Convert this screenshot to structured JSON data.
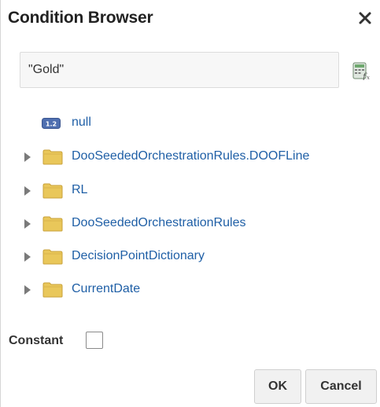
{
  "dialog": {
    "title": "Condition Browser",
    "close_icon": "close-icon"
  },
  "search": {
    "value": "\"Gold\"",
    "placeholder": ""
  },
  "expression_builder": {
    "icon": "expression-builder-icon"
  },
  "tree": {
    "items": [
      {
        "label": "null",
        "icon": "null-value-icon",
        "expandable": false
      },
      {
        "label": "DooSeededOrchestrationRules.DOOFLine",
        "icon": "folder-icon",
        "expandable": true
      },
      {
        "label": "RL",
        "icon": "folder-icon",
        "expandable": true
      },
      {
        "label": "DooSeededOrchestrationRules",
        "icon": "folder-icon",
        "expandable": true
      },
      {
        "label": "DecisionPointDictionary",
        "icon": "folder-icon",
        "expandable": true
      },
      {
        "label": "CurrentDate",
        "icon": "folder-icon",
        "expandable": true
      }
    ]
  },
  "constant": {
    "label": "Constant",
    "checked": false
  },
  "buttons": {
    "ok_label": "OK",
    "cancel_label": "Cancel"
  },
  "colors": {
    "link": "#1f5fa6",
    "folder": "#e9c75a",
    "title": "#222222"
  }
}
